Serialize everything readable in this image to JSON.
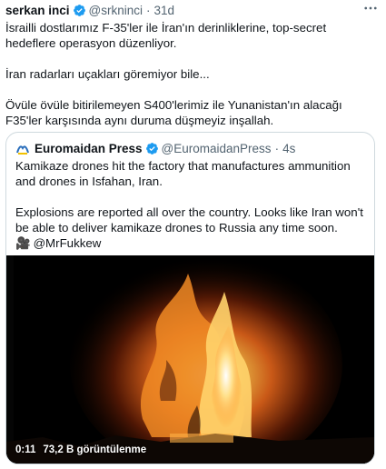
{
  "tweet": {
    "author_name": "serkan inci",
    "handle": "@srkninci",
    "separator": "·",
    "time": "31d",
    "more_icon": "more-icon",
    "paragraphs": [
      "İsrailli dostlarımız F-35'ler ile İran'ın derinliklerine, top-secret hedeflere operasyon düzenliyor.",
      "İran radarları uçakları göremiyor bile...",
      "Övüle övüle bitirilemeyen S400'lerimiz ile Yunanistan'ın alacağı F35'ler karşısında aynı duruma düşmeyiz inşallah."
    ],
    "verified_color": "#1d9bf0"
  },
  "quote": {
    "author_name": "Euromaidan Press",
    "handle": "@EuromaidanPress",
    "separator": "·",
    "time": "4s",
    "paragraph1": "Kamikaze drones hit the factory that manufactures ammunition and drones in Isfahan, Iran.",
    "paragraph2": "Explosions are reported all over the country. Looks like Iran won't be able to deliver kamikaze drones to Russia any time soon.",
    "credit_icon": "video-camera-icon",
    "credit_glyph": "🎥",
    "credit_handle": "@MrFukkew",
    "media": {
      "elapsed": "0:11",
      "views": "73,2 B görüntülenme"
    }
  }
}
